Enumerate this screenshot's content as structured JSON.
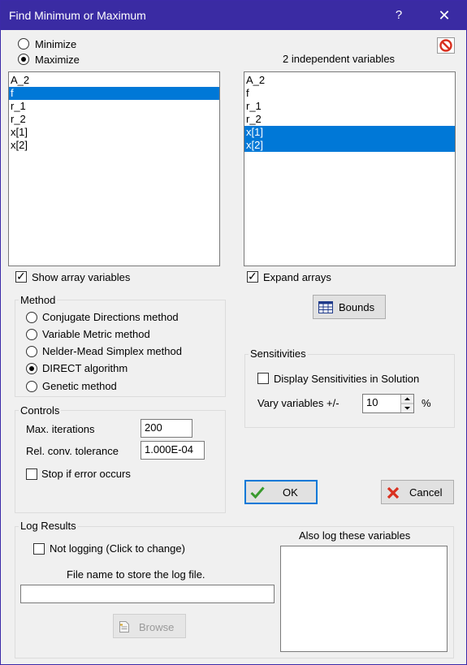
{
  "window": {
    "title": "Find Minimum or Maximum",
    "help": "?",
    "close": "✕"
  },
  "goal": {
    "minimize": "Minimize",
    "maximize": "Maximize",
    "selected": "maximize"
  },
  "independent_header": "2 independent variables",
  "left_list": {
    "items": [
      "A_2",
      "f",
      "r_1",
      "r_2",
      "x[1]",
      "x[2]"
    ],
    "selected": [
      "f"
    ]
  },
  "right_list": {
    "items": [
      "A_2",
      "f",
      "r_1",
      "r_2",
      "x[1]",
      "x[2]"
    ],
    "selected": [
      "x[1]",
      "x[2]"
    ]
  },
  "show_array_variables": {
    "label": "Show array variables",
    "checked": true
  },
  "expand_arrays": {
    "label": "Expand arrays",
    "checked": true
  },
  "method": {
    "title": "Method",
    "options": [
      "Conjugate Directions method",
      "Variable Metric method",
      "Nelder-Mead Simplex method",
      "DIRECT algorithm",
      "Genetic method"
    ],
    "selected": "DIRECT algorithm"
  },
  "bounds_label": "Bounds",
  "sensitivities": {
    "title": "Sensitivities",
    "display_label": "Display Sensitivities in Solution",
    "display_checked": false,
    "vary_label": "Vary variables +/-",
    "vary_value": "10",
    "percent": "%"
  },
  "controls": {
    "title": "Controls",
    "max_iter_label": "Max. iterations",
    "max_iter_value": "200",
    "tol_label": "Rel. conv. tolerance",
    "tol_value": "1.000E-04",
    "stop_label": "Stop if error occurs",
    "stop_checked": false
  },
  "ok_label": "OK",
  "cancel_label": "Cancel",
  "log": {
    "title": "Log Results",
    "not_logging_label": "Not logging (Click to change)",
    "not_logging_checked": false,
    "file_label": "File name to store the log file.",
    "file_value": "",
    "browse_label": "Browse",
    "also_log_label": "Also log these variables"
  },
  "colors": {
    "titlebar": "#3a2ba3",
    "selection": "#0078d7",
    "cancel_icon": "#d9301f",
    "ok_icon": "#3a9a2e"
  }
}
